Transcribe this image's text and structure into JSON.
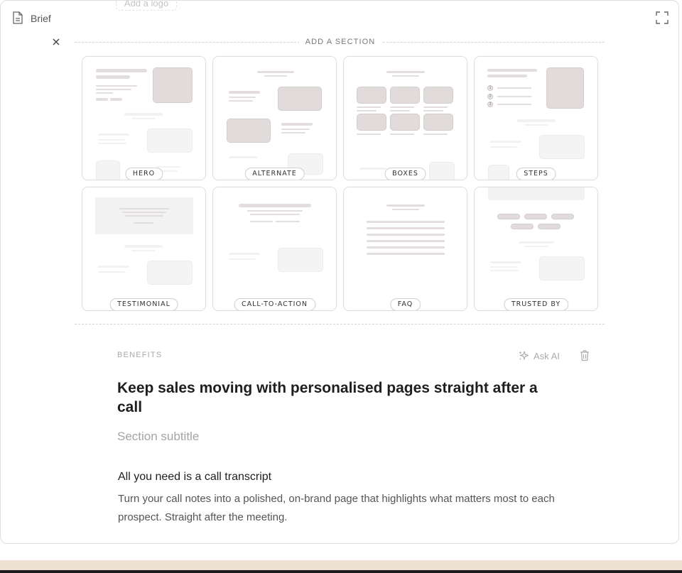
{
  "topbar": {
    "doc_icon": "document-icon",
    "title": "Brief",
    "ghost_logo": "Add a logo",
    "expand_icon": "expand-icon"
  },
  "picker": {
    "close_icon": "close-icon",
    "heading": "ADD A SECTION",
    "templates": [
      {
        "label": "HERO"
      },
      {
        "label": "ALTERNATE"
      },
      {
        "label": "BOXES"
      },
      {
        "label": "STEPS"
      },
      {
        "label": "TESTIMONIAL"
      },
      {
        "label": "CALL-TO-ACTION"
      },
      {
        "label": "FAQ"
      },
      {
        "label": "TRUSTED BY"
      }
    ],
    "step_numbers": [
      "1",
      "2",
      "3"
    ]
  },
  "section": {
    "label": "BENEFITS",
    "ask_ai": "Ask AI",
    "ask_ai_icon": "sparkles-icon",
    "delete_icon": "trash-icon",
    "title": "Keep sales moving with personalised pages straight after a call",
    "subtitle": "Section subtitle",
    "feature": {
      "title": "All you need is a call transcript",
      "body": "Turn your call notes into a polished, on-brand page that highlights what matters most to each prospect. Straight after the meeting."
    }
  },
  "colors": {
    "placeholder": "#e3dedd",
    "border": "#dcdcdc",
    "bottom_strip": "#ede1cf"
  }
}
